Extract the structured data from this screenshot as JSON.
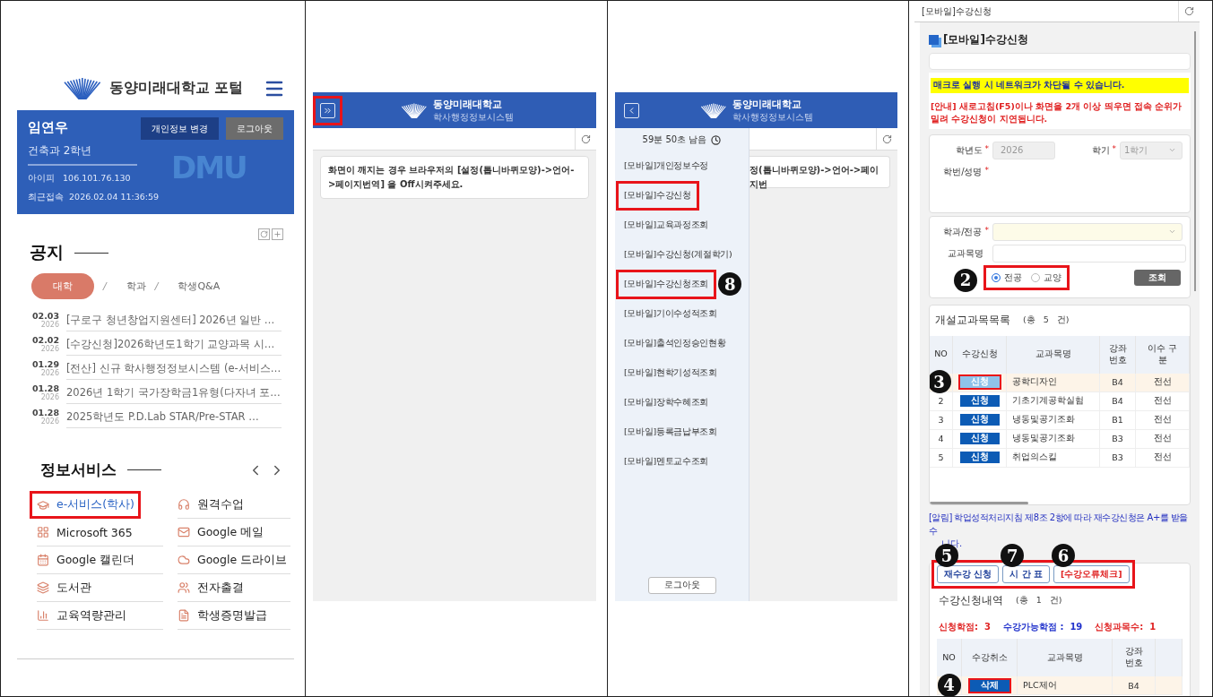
{
  "portal": {
    "logo_title": "동양미래대학교 포털",
    "profile": {
      "name": "임연우",
      "dept": "건축과 2학년",
      "ip_label": "아이피",
      "ip": "106.101.76.130",
      "last_label": "최근접속",
      "last": "2026.02.04 11:36:59",
      "watermark": "DMU",
      "buttons": [
        {
          "label": "개인정보 변경",
          "kind": "primary"
        },
        {
          "label": "로그아웃",
          "kind": "secondary"
        }
      ]
    },
    "notice": {
      "title": "공지",
      "separator": "/",
      "tabs": [
        {
          "label": "대학",
          "selected": true
        },
        {
          "label": "학과",
          "selected": false
        },
        {
          "label": "학생Q&A",
          "selected": false
        }
      ],
      "items": [
        {
          "date": "02.03",
          "year": "2026",
          "title": "[구로구 청년창업지원센터] 2026년 일반 …"
        },
        {
          "date": "02.02",
          "year": "2026",
          "title": "[수강신청]2026학년도1학기 교양과목 시…"
        },
        {
          "date": "01.29",
          "year": "2026",
          "title": "[전산] 신규 학사행정정보시스템 (e-서비스…"
        },
        {
          "date": "01.28",
          "year": "2026",
          "title": "2026년 1학기 국가장학금1유형(다자녀 포…"
        },
        {
          "date": "01.28",
          "year": "2026",
          "title": "2025학년도 P.D.Lab STAR/Pre-STAR …"
        }
      ]
    },
    "services": {
      "title": "정보서비스",
      "items": [
        {
          "label": "e-서비스(학사)",
          "highlighted": true
        },
        {
          "label": "원격수업",
          "highlighted": false
        },
        {
          "label": "Microsoft 365",
          "highlighted": false
        },
        {
          "label": "Google 메일",
          "highlighted": false
        },
        {
          "label": "Google 캘린더",
          "highlighted": false
        },
        {
          "label": "Google 드라이브",
          "highlighted": false
        },
        {
          "label": "도서관",
          "highlighted": false
        },
        {
          "label": "전자출결",
          "highlighted": false
        },
        {
          "label": "교육역량관리",
          "highlighted": false
        },
        {
          "label": "학생증명발급",
          "highlighted": false
        }
      ]
    }
  },
  "collapsed_app": {
    "title": "동양미래대학교",
    "subtitle": "학사행정정보시스템",
    "expand_highlighted": true,
    "message": "화면이 깨지는 경우 브라우저의 [설정(톱니바퀴모양)->언어->페이지번역] 을 Off시켜주세요."
  },
  "menu_app": {
    "title": "동양미래대학교",
    "subtitle": "학사행정정보시스템",
    "timer": "59분 50초 남음",
    "message_visible": "정(톱니바퀴모양)->언어->페이지번",
    "menu": [
      {
        "label": "[모바일]개인정보수정",
        "highlighted": false
      },
      {
        "label": "[모바일]수강신청",
        "highlighted": true
      },
      {
        "label": "[모바일]교육과정조회",
        "highlighted": false
      },
      {
        "label": "[모바일]수강신청(계절학기)",
        "highlighted": false
      },
      {
        "label": "[모바일]수강신청조회",
        "highlighted": true,
        "marker": "8"
      },
      {
        "label": "[모바일]기이수성적조회",
        "highlighted": false
      },
      {
        "label": "[모바일]출석인정승인현황",
        "highlighted": false
      },
      {
        "label": "[모바일]현학기성적조회",
        "highlighted": false
      },
      {
        "label": "[모바일]장학수혜조회",
        "highlighted": false
      },
      {
        "label": "[모바일]등록금납부조회",
        "highlighted": false
      },
      {
        "label": "[모바일]멘토교수조회",
        "highlighted": false
      }
    ],
    "logout": "로그아웃"
  },
  "registration": {
    "window_title": "[모바일]수강신청",
    "heading": "[모바일]수강신청",
    "warning": "매크로 실행 시 네트워크가 차단될 수 있습니다.",
    "notice": "[안내] 새로고침(F5)이나 화면을 2개 이상 띄우면 접속 순위가 밀려 수강신청이 지연됩니다.",
    "required_mark": "*",
    "form": {
      "year_label": {
        "text": "학년도",
        "required": true
      },
      "year": "2026",
      "term_label": {
        "text": "학기",
        "required": true
      },
      "term": "1학기",
      "student_label": {
        "text": "학번/성명",
        "required": true
      }
    },
    "filter": {
      "dept_label": {
        "text": "학과/전공",
        "required": true
      },
      "course_label": {
        "text": "교과목명",
        "required": false
      },
      "highlighted": true,
      "marker": "2",
      "search": "조회",
      "radios": [
        {
          "label": "전공",
          "selected": true
        },
        {
          "label": "교양",
          "selected": false
        }
      ]
    },
    "course_list": {
      "title": "개설교과목목록",
      "count": "(총 5 건)",
      "columns": [
        "NO",
        "수강신청",
        "교과목명",
        "강좌 번호",
        "이수 구분"
      ],
      "rows": [
        {
          "action": "신청",
          "name": "공학디자인",
          "section": "B4",
          "type": "전선",
          "selected": true,
          "highlighted": true,
          "marker": "3"
        },
        {
          "no": "2",
          "action": "신청",
          "name": "기초기계공학실험",
          "section": "B4",
          "type": "전선",
          "selected": false,
          "highlighted": false
        },
        {
          "no": "3",
          "action": "신청",
          "name": "냉동및공기조화",
          "section": "B1",
          "type": "전선",
          "selected": false,
          "highlighted": false
        },
        {
          "no": "4",
          "action": "신청",
          "name": "냉동및공기조화",
          "section": "B3",
          "type": "전선",
          "selected": false,
          "highlighted": false
        },
        {
          "no": "5",
          "action": "신청",
          "name": "취업의스킬",
          "section": "B3",
          "type": "전선",
          "selected": false,
          "highlighted": false
        }
      ]
    },
    "retake_notice": "[알림] 학업성적처리지침 제8조 2항에 따라 재수강신청은 A+를 받을 수",
    "retake_notice_tail": "니다.",
    "actions_highlighted": true,
    "actions": [
      {
        "label": "재수강 신청",
        "kind": "normal",
        "marker": "5"
      },
      {
        "label": "시 간 표",
        "kind": "normal",
        "marker": "7"
      },
      {
        "label": "[수강오류체크]",
        "kind": "alert",
        "marker": "6"
      }
    ],
    "history": {
      "title": "수강신청내역",
      "count": "(총 1 건)",
      "stats": [
        {
          "label": "신청학점:",
          "value": "3",
          "color": "#e02424"
        },
        {
          "label": "수강가능학점 :",
          "value": "19",
          "color": "#2233cc"
        },
        {
          "label": "신청과목수:",
          "value": "1",
          "color": "#e02424"
        }
      ],
      "columns": [
        "NO",
        "수강취소",
        "교과목명",
        "강좌 번호"
      ],
      "rows": [
        {
          "action": "삭제",
          "name": "PLC제어",
          "section": "B4",
          "highlighted": true,
          "marker": "4"
        }
      ]
    }
  }
}
